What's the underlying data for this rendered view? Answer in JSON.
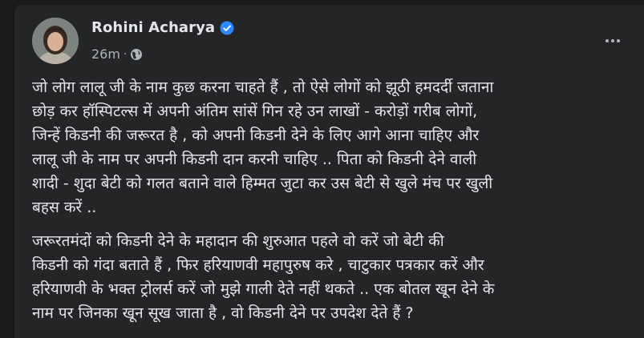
{
  "post": {
    "author": "Rohini Acharya",
    "timestamp": "26m",
    "separator": "·",
    "verified_icon": "verified-badge-icon",
    "audience_icon": "globe-icon",
    "more_icon": "more-options-icon",
    "paragraphs": [
      "जो लोग लालू जी के नाम कुछ करना चाहते हैं , तो ऐसे लोगों को झूठी हमदर्दी जताना\nछोड़ कर हॉस्पिटल्स में अपनी अंतिम सांसें गिन रहे उन लाखों - करोड़ों गरीब लोगों,\nजिन्हें किडनी की जरूरत है , को अपनी किडनी देने के लिए आगे आना चाहिए और\nलालू जी के नाम पर अपनी किडनी दान करनी चाहिए .. पिता को किडनी देने वाली\nशादी - शुदा बेटी को गलत बताने वाले हिम्मत जुटा कर उस बेटी से खुले मंच पर खुली\nबहस करें ..",
      "जरूरतमंदों  को किडनी देने के महादान की शुरुआत पहले वो करें जो बेटी की\nकिडनी को गंदा बताते हैं , फिर हरियाणवी महापुरुष करे , चाटुकार पत्रकार करें और\nहरियाणवी के भक्त ट्रोलर्स करें जो मुझे गाली देते नहीं थकते .. एक बोतल खून देने के\nनाम पर जिनका खून सूख जाता है , वो किडनी देने पर उपदेश देते हैं ?"
    ]
  },
  "colors": {
    "page_bg": "#18191a",
    "card_bg": "#242526",
    "primary_text": "#e4e6eb",
    "secondary_text": "#b0b3b8",
    "verified_blue": "#2d88ff"
  }
}
